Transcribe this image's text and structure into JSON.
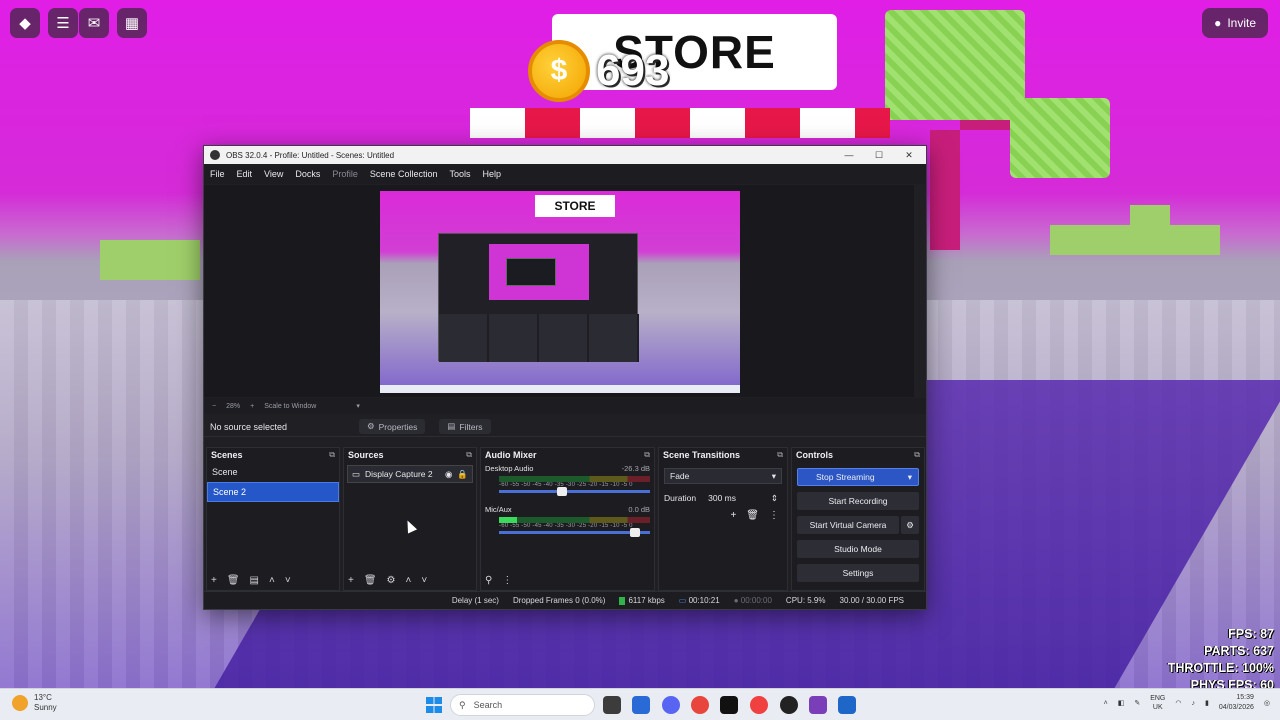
{
  "game": {
    "store_title": "STORE",
    "coins": "693",
    "coin_symbol": "$",
    "invite_label": "Invite",
    "stats": [
      "FPS: 87",
      "PARTS: 637",
      "THROTTLE: 100%",
      "PHYS FPS: 60"
    ]
  },
  "obs": {
    "window_title": "OBS 32.0.4 - Profile: Untitled - Scenes: Untitled",
    "menu": [
      "File",
      "Edit",
      "View",
      "Docks",
      "Profile",
      "Scene Collection",
      "Tools",
      "Help"
    ],
    "preview_store": "STORE",
    "zoom": {
      "minus": "−",
      "value": "28%",
      "plus": "+",
      "mode": "Scale to Window"
    },
    "no_source": "No source selected",
    "properties_label": "Properties",
    "filters_label": "Filters",
    "scenes": {
      "title": "Scenes",
      "items": [
        "Scene",
        "Scene 2"
      ],
      "selected": 1
    },
    "sources": {
      "title": "Sources",
      "items": [
        "Display Capture 2"
      ]
    },
    "mixer": {
      "title": "Audio Mixer",
      "channels": [
        {
          "name": "Desktop Audio",
          "db": "-26.3 dB",
          "level": 0.0,
          "fader": 0.42
        },
        {
          "name": "Mic/Aux",
          "db": "0.0 dB",
          "level": 0.12,
          "fader": 0.9
        }
      ],
      "scale": "-60 -55 -50 -45 -40 -35 -30 -25 -20 -15 -10 -5 0"
    },
    "transitions": {
      "title": "Scene Transitions",
      "type": "Fade",
      "duration_label": "Duration",
      "duration": "300 ms"
    },
    "controls": {
      "title": "Controls",
      "buttons": [
        "Stop Streaming",
        "Start Recording",
        "Start Virtual Camera",
        "Studio Mode",
        "Settings"
      ]
    },
    "status": {
      "delay": "Delay (1 sec)",
      "dropped": "Dropped Frames 0 (0.0%)",
      "bitrate": "6117 kbps",
      "stream_time": "00:10:21",
      "rec_time": "00:00:00",
      "cpu": "CPU: 5.9%",
      "fps": "30.00 / 30.00 FPS"
    },
    "accent": "#2b56c4"
  },
  "taskbar": {
    "weather_temp": "13°C",
    "weather_desc": "Sunny",
    "search_placeholder": "Search",
    "lang1": "ENG",
    "lang2": "UK",
    "time": "15:39",
    "date": "04/03/2026"
  }
}
